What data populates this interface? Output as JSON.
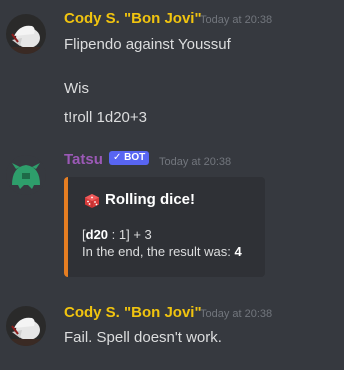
{
  "colors": {
    "background": "#36393f",
    "cody_name": "#f1c40f",
    "tatsu_name": "#9b59b6",
    "bot_badge": "#5865f2",
    "embed_accent": "#e67e22",
    "embed_bg": "#2f3136"
  },
  "messages": [
    {
      "author": "Cody S. \"Bon Jovi\"",
      "timestamp": "Today at 20:38",
      "avatar_icon": "white-horse-avatar-icon",
      "lines": [
        "Flipendo against Youssuf",
        "Wis",
        "t!roll 1d20+3"
      ]
    },
    {
      "author": "Tatsu",
      "badge": "✓ BOT",
      "timestamp": "Today at 20:38",
      "avatar_icon": "tatsu-dragon-avatar-icon",
      "embed": {
        "title": "Rolling dice!",
        "die_icon": "red-die-icon",
        "roll_prefix": "[",
        "roll_die": "d20",
        "roll_suffix": " : 1] + 3",
        "result_prefix": "In the end, the result was: ",
        "result_value": "4"
      }
    },
    {
      "author": "Cody S. \"Bon Jovi\"",
      "timestamp": "Today at 20:38",
      "avatar_icon": "white-horse-avatar-icon",
      "lines": [
        "Fail. Spell doesn't work."
      ]
    }
  ]
}
